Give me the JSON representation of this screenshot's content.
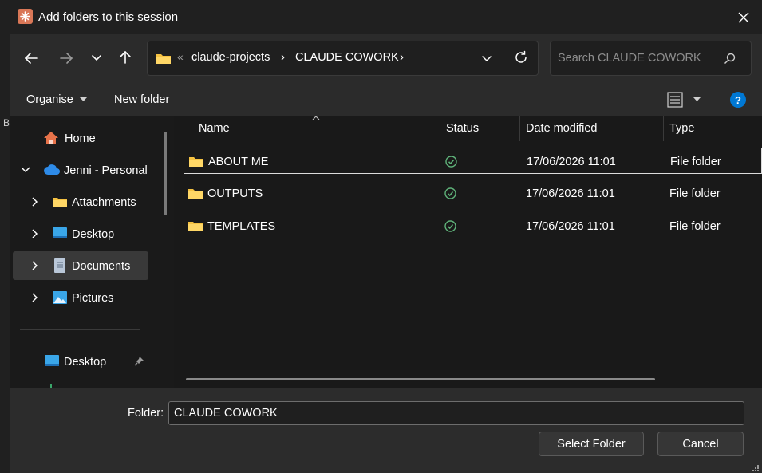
{
  "dialog": {
    "title": "Add folders to this session",
    "close_glyph": "✕",
    "backdrop_letter": "B"
  },
  "nav": {
    "back_icon": "arrow-left-icon",
    "forward_icon": "arrow-right-icon",
    "recent_icon": "chevron-down-icon",
    "up_icon": "arrow-up-icon"
  },
  "address": {
    "overflow": "«",
    "crumbs": [
      {
        "label": "claude-projects"
      },
      {
        "label": "CLAUDE COWORK"
      }
    ],
    "sep": "›"
  },
  "search": {
    "placeholder": "Search CLAUDE COWORK"
  },
  "toolbar": {
    "organise_label": "Organise",
    "new_folder_label": "New folder",
    "help_label": "?"
  },
  "navpane": {
    "items": [
      {
        "label": "Home",
        "icon": "home-icon"
      },
      {
        "label": "Jenni - Personal",
        "icon": "cloud-icon"
      },
      {
        "label": "Attachments",
        "icon": "folder-icon"
      },
      {
        "label": "Desktop",
        "icon": "desktop-icon"
      },
      {
        "label": "Documents",
        "icon": "document-icon"
      },
      {
        "label": "Pictures",
        "icon": "pictures-icon"
      },
      {
        "label": "Desktop",
        "icon": "desktop-icon"
      }
    ]
  },
  "columns": {
    "name": "Name",
    "status": "Status",
    "date": "Date modified",
    "type": "Type"
  },
  "rows": [
    {
      "name": "ABOUT ME",
      "date": "17/06/2026 11:01",
      "type": "File folder"
    },
    {
      "name": "OUTPUTS",
      "date": "17/06/2026 11:01",
      "type": "File folder"
    },
    {
      "name": "TEMPLATES",
      "date": "17/06/2026 11:01",
      "type": "File folder"
    }
  ],
  "footer": {
    "folder_label": "Folder:",
    "folder_value": "CLAUDE COWORK",
    "select_label": "Select Folder",
    "cancel_label": "Cancel"
  },
  "colors": {
    "accent": "#0078d4",
    "folder": "#f5c242",
    "status_ok": "#5fb37a",
    "app_icon": "#d97757"
  }
}
